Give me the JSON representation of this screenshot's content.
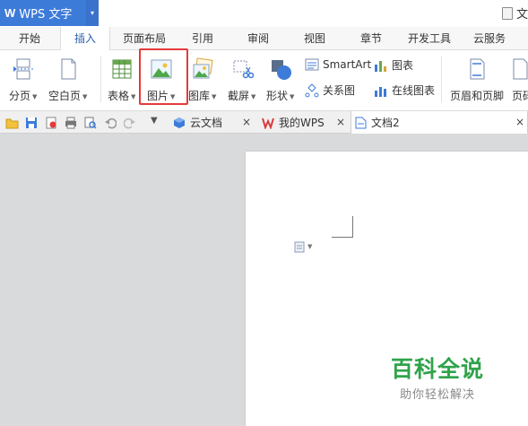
{
  "titlebar": {
    "app_logo": "W",
    "app_title": "WPS 文字",
    "caret": "▾",
    "doc_title": "文"
  },
  "tabs": [
    "开始",
    "插入",
    "页面布局",
    "引用",
    "审阅",
    "视图",
    "章节",
    "开发工具",
    "云服务"
  ],
  "active_tab": "插入",
  "ribbon": {
    "page_break": "分页",
    "blank_page": "空白页",
    "table": "表格",
    "picture": "图片",
    "gallery": "图库",
    "screenshot": "截屏",
    "shape": "形状",
    "smartart": "SmartArt",
    "relation": "关系图",
    "chart": "图表",
    "online_chart": "在线图表",
    "header_footer": "页眉和页脚",
    "page_number": "页码"
  },
  "doc_tabs": [
    {
      "label": "云文档"
    },
    {
      "label": "我的WPS"
    },
    {
      "label": "文档2"
    }
  ],
  "close_glyph": "×",
  "watermark": {
    "title": "百科全说",
    "subtitle": "助你轻松解决"
  },
  "colors": {
    "accent": "#3d7bd9",
    "highlight": "#e53a3a",
    "watermark_green": "#2fa34a"
  }
}
